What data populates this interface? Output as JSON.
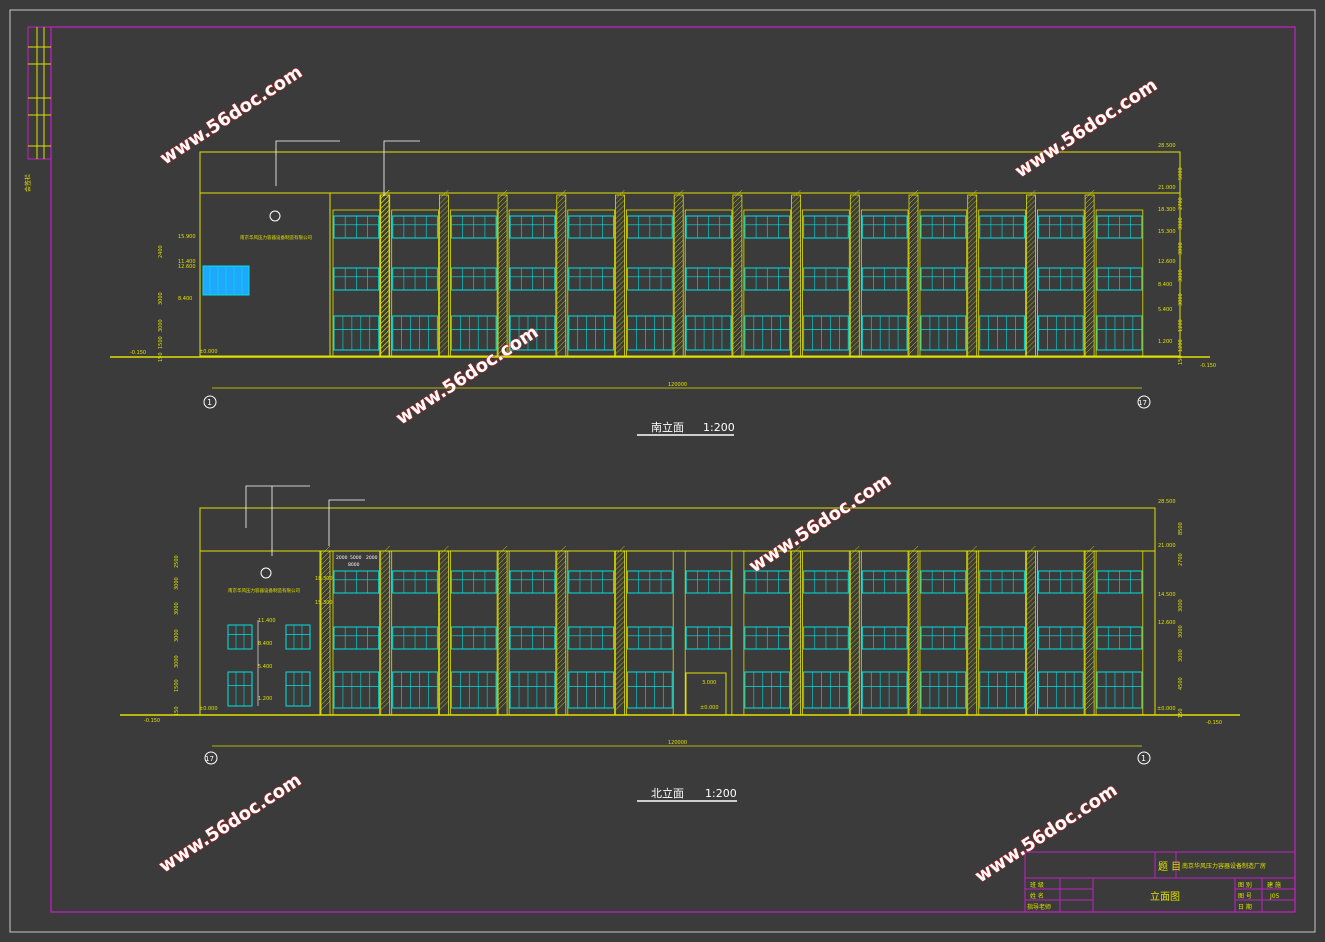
{
  "drawing": {
    "south_elevation": {
      "title": "南立面",
      "scale": "1:200",
      "total_width": "120000",
      "axis_left": "1",
      "axis_right": "17",
      "left_grade": "-0.150",
      "right_grade": "-0.150",
      "left_zero": "±0.000",
      "left_elevs": [
        "15.900",
        "12.600",
        "11.400",
        "8.400"
      ],
      "left_dims": [
        "2400",
        "3000",
        "3000",
        "1500",
        "150"
      ],
      "right_elevs": [
        "28.500",
        "21.000",
        "18.300",
        "15.300",
        "12.600",
        "8.400",
        "5.400",
        "1.200"
      ],
      "right_dims": [
        "5000",
        "2700",
        "3000",
        "3000",
        "3000",
        "3000",
        "1200",
        "1200",
        "150"
      ],
      "sign_text": "南京华风压力容器设备制造有限公司"
    },
    "north_elevation": {
      "title": "北立面",
      "scale": "1:200",
      "total_width": "120000",
      "axis_left": "17",
      "axis_right": "1",
      "left_grade": "-0.150",
      "right_grade": "-0.150",
      "left_zero": "±0.000",
      "right_zero": "±0.000",
      "door_top": "3.000",
      "door_bottom": "±0.000",
      "left_elevs": [
        "18.300",
        "15.300"
      ],
      "mid_elevs": [
        "11.400",
        "8.400",
        "5.400",
        "1.200"
      ],
      "left_dims": [
        "2500",
        "3000",
        "3000",
        "3000",
        "3000",
        "1500",
        "150"
      ],
      "right_elevs": [
        "28.500",
        "21.000",
        "14.500",
        "12.600"
      ],
      "right_dims": [
        "8500",
        "2700",
        "3000",
        "3000",
        "3000",
        "4500",
        "150"
      ],
      "top_dims": [
        "2000",
        "5000",
        "2000",
        "8000"
      ],
      "sign_text": "南京华风压力容器设备制造有限公司"
    }
  },
  "watermarks": [
    "www.56doc.com",
    "www.56doc.com",
    "www.56doc.com",
    "www.56doc.com",
    "www.56doc.com",
    "www.56doc.com",
    "www.56doc.com"
  ],
  "title_block": {
    "label_title": "题 目",
    "project": "南京华风压力容器设备制造厂房",
    "drawing_name": "立面图",
    "row1": "班 级",
    "row2": "姓 名",
    "row3": "指导老师",
    "r_row1a": "图 别",
    "r_row1b": "建 施",
    "r_row2a": "图 号",
    "r_row2b": "J05",
    "r_row3a": "日 期"
  },
  "side_label": "会签栏"
}
